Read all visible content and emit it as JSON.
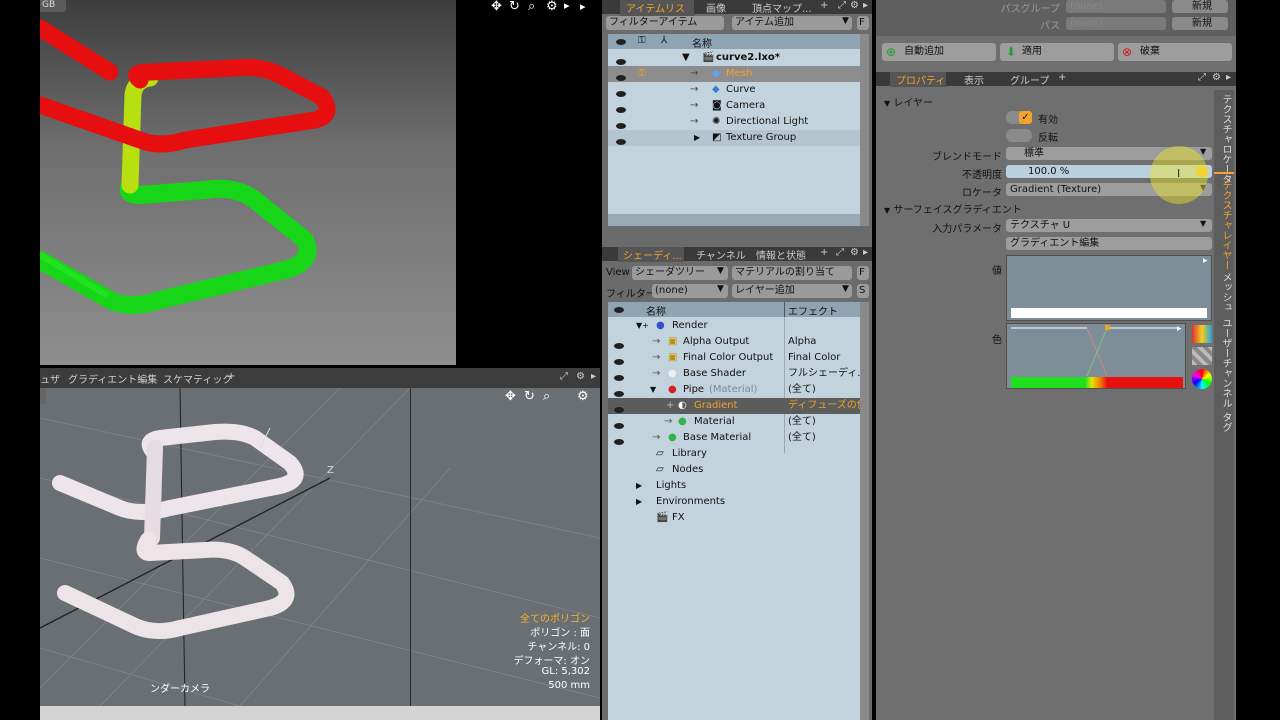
{
  "viewport_top": {
    "label": "GB",
    "tools": [
      "✥",
      "↻",
      "🔍",
      "⚙",
      "▸"
    ]
  },
  "viewport_bottom": {
    "tabs": [
      "ュザ",
      "グラディエント編集",
      "スケマティック",
      "+"
    ],
    "tools": [
      "✥",
      "↻",
      "🔍",
      "⚙"
    ],
    "camera_label": "ンダーカメラ",
    "info": {
      "line1": "全てのポリゴン",
      "line2": "ポリゴン : 面",
      "line3": "チャンネル: 0",
      "line4": "デフォーマ: オン",
      "line5": "GL: 5,302",
      "line6": "500 mm"
    }
  },
  "item_list": {
    "tabs": [
      "アイテムリスト",
      "画像",
      "頂点マップ..."
    ],
    "filter_label": "フィルターアイテム",
    "add_item_label": "アイテム追加",
    "f_label": "F",
    "header_name": "名称",
    "rows": [
      {
        "name": "curve2.lxo*",
        "indent": 0
      },
      {
        "name": "Mesh",
        "indent": 1
      },
      {
        "name": "Curve",
        "indent": 1
      },
      {
        "name": "Camera",
        "indent": 1
      },
      {
        "name": "Directional Light",
        "indent": 1
      },
      {
        "name": "Texture Group",
        "indent": 1
      }
    ]
  },
  "shader": {
    "tabs": [
      "シェーディ...",
      "チャンネル",
      "情報と状態"
    ],
    "view_label": "View",
    "view_value": "シェーダツリー",
    "assign_material": "マテリアルの割り当て",
    "f_label": "F",
    "filter_label": "フィルター",
    "filter_value": "(none)",
    "add_layer": "レイヤー追加",
    "s_label": "S",
    "header_name": "名称",
    "header_effect": "エフェクト",
    "rows": [
      {
        "name": "Render",
        "effect": ""
      },
      {
        "name": "Alpha Output",
        "effect": "Alpha"
      },
      {
        "name": "Final Color Output",
        "effect": "Final Color"
      },
      {
        "name": "Base Shader",
        "effect": "フルシェーディ..."
      },
      {
        "name": "Pipe",
        "sub": "(Material)",
        "effect": "(全て)"
      },
      {
        "name": "Gradient",
        "effect": "ディフューズの色"
      },
      {
        "name": "Material",
        "effect": "(全て)"
      },
      {
        "name": "Base Material",
        "effect": "(全て)"
      },
      {
        "name": "Library",
        "effect": ""
      },
      {
        "name": "Nodes",
        "effect": ""
      },
      {
        "name": "Lights",
        "effect": ""
      },
      {
        "name": "Environments",
        "effect": ""
      },
      {
        "name": "FX",
        "effect": ""
      }
    ]
  },
  "properties": {
    "top": {
      "pass_group_label": "パスグループ",
      "pass_group_value": "(none)",
      "pass_label": "パス",
      "pass_value": "(none)",
      "new1": "新規",
      "new2": "新規"
    },
    "actions": {
      "auto_add": "自動追加",
      "apply": "適用",
      "discard": "破棄"
    },
    "tabs": [
      "プロパティ",
      "表示",
      "グループ",
      "+"
    ],
    "layer_section": "レイヤー",
    "enable": "有効",
    "invert": "反転",
    "blend_mode_label": "ブレンドモード",
    "blend_mode_value": "標準",
    "opacity_label": "不透明度",
    "opacity_value": "100.0 %",
    "locator_label": "ロケータ",
    "locator_value": "Gradient (Texture)",
    "surface_gradient_section": "サーフェイスグラディエント",
    "input_param_label": "入力パラメータ",
    "input_param_value": "テクスチャ U",
    "gradient_edit": "グラディエント編集",
    "value_label": "値",
    "color_label": "色",
    "side_tabs": [
      "テクスチャロケータ",
      "テクスチャレイヤー",
      "メッシュ",
      "ユーザーチャンネル",
      "タグ"
    ]
  },
  "colors": {
    "accent": "#f3a32c",
    "pipe_red": "#e81010",
    "pipe_green": "#19e019",
    "list_bg": "#c3d3dd"
  }
}
